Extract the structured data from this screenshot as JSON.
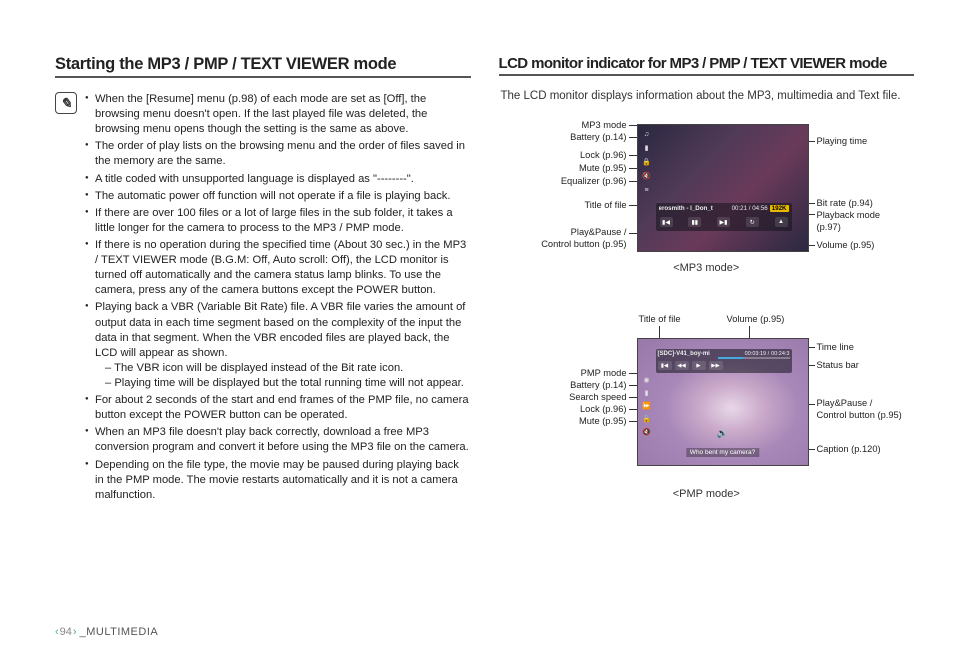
{
  "left": {
    "heading": "Starting the MP3 / PMP / TEXT VIEWER mode",
    "note_icon": "✎",
    "bullets": [
      "When the [Resume] menu (p.98) of each mode are set as [Off], the browsing menu doesn't open. If the last played file was deleted, the browsing menu opens though the setting is the same as above.",
      "The order of play lists on the browsing menu and the order of files saved in the memory are the same.",
      "A title coded with unsupported language is displayed as \"--------\".",
      "The automatic power off function will not operate if a file is playing back.",
      "If there are over 100 files or a lot of large files in the sub folder, it takes a little longer for the camera to process to the MP3 / PMP mode.",
      "If there is no operation during the specified time (About 30 sec.) in the MP3 / TEXT VIEWER mode (B.G.M: Off, Auto scroll: Off), the LCD monitor is turned off automatically and the camera status lamp blinks. To use the camera, press any of the camera buttons except the POWER button.",
      "Playing back a VBR (Variable Bit Rate) file. A VBR file varies the amount of output data in each time segment based on the complexity of the input the data in that segment. When the VBR encoded files are played back, the LCD will appear as shown.",
      "For about 2 seconds of the start and end frames of the PMP file, no camera button except the POWER button can be operated.",
      "When an MP3 file doesn't play back correctly, download a free MP3 conversion program and convert it before using the MP3 file on the camera.",
      "Depending on the file type, the movie may be paused during playing back in the PMP mode. The movie restarts automatically and it is not a camera malfunction."
    ],
    "sublines": {
      "vbr1": "– The VBR icon will be displayed instead of the Bit rate icon.",
      "vbr2": "– Playing time will be displayed but the total running time will not appear."
    }
  },
  "right": {
    "heading": "LCD monitor indicator for MP3 / PMP / TEXT VIEWER mode",
    "intro": "The LCD monitor displays information about the MP3, multimedia and Text file.",
    "mp3": {
      "mode_label": "<MP3 mode>",
      "title_text": "erosmith - I_Don_t",
      "time_text": "00:21 / 04:56",
      "rate_text": "192K",
      "labels_left": {
        "l1": "MP3 mode",
        "l2": "Battery (p.14)",
        "l3": "Lock (p.96)",
        "l4": "Mute (p.95)",
        "l5": "Equalizer (p.96)",
        "l6": "Title of file",
        "l7a": "Play&Pause /",
        "l7b": "Control button (p.95)"
      },
      "labels_right": {
        "r1": "Playing time",
        "r2": "Bit rate (p.94)",
        "r3a": "Playback mode",
        "r3b": "(p.97)",
        "r4": "Volume (p.95)"
      }
    },
    "pmp": {
      "mode_label": "<PMP mode>",
      "title_text": "[SDC]-V41_boy-mi",
      "time_text": "00:24:3",
      "time_text2": "00:03:19 /",
      "caption": "Who bent my camera?",
      "labels_top": {
        "t1": "Title of file",
        "t2": "Volume (p.95)"
      },
      "labels_left": {
        "l1": "PMP mode",
        "l2": "Battery (p.14)",
        "l3": "Search speed",
        "l4": "Lock (p.96)",
        "l5": "Mute (p.95)"
      },
      "labels_right": {
        "r1": "Time line",
        "r2": "Status bar",
        "r3a": "Play&Pause /",
        "r3b": "Control button (p.95)",
        "r4": "Caption (p.120)"
      }
    }
  },
  "footer": {
    "page": "94",
    "section": "_MULTIMEDIA"
  }
}
